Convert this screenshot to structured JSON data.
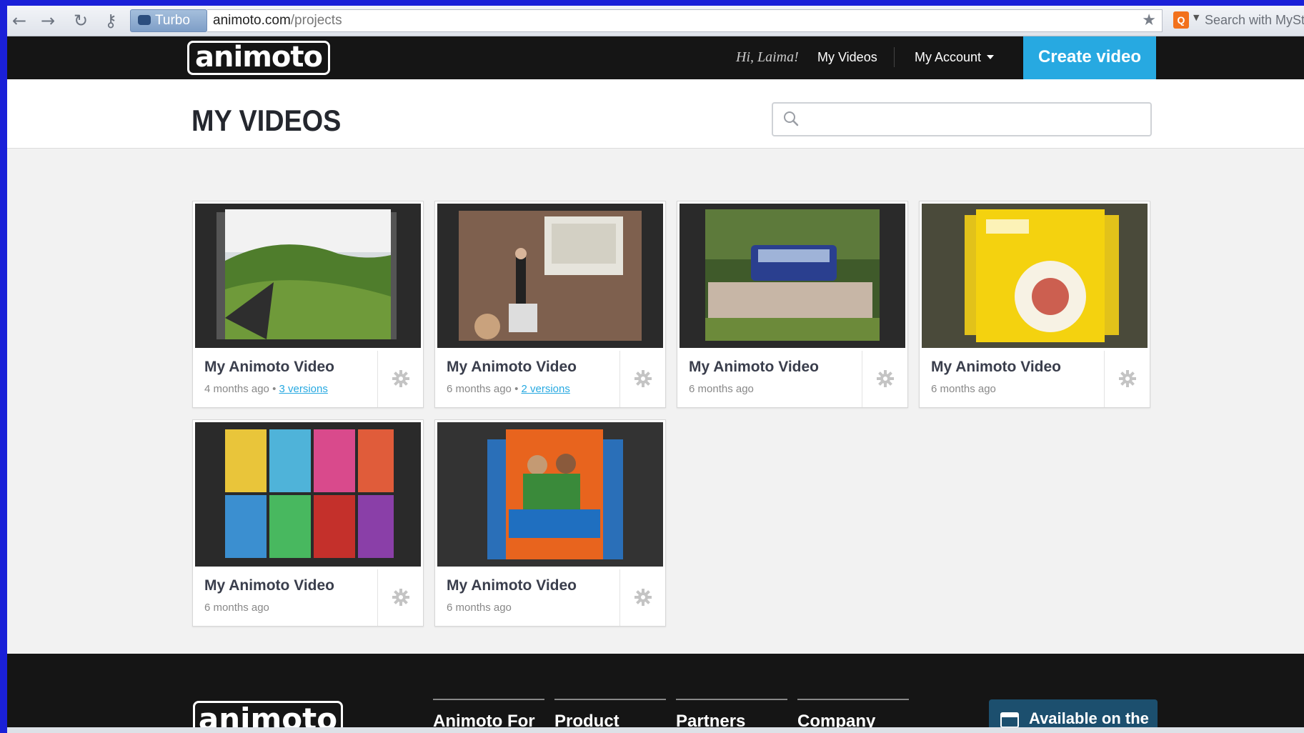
{
  "browser": {
    "turbo_label": "Turbo",
    "url_domain": "animoto.com",
    "url_path": "/projects",
    "search_placeholder": "Search with MyStart"
  },
  "header": {
    "logo_text": "animoto",
    "greeting": "Hi, Laima!",
    "my_videos": "My Videos",
    "my_account": "My Account",
    "create_video": "Create video"
  },
  "page": {
    "title": "MY VIDEOS",
    "search_placeholder": ""
  },
  "videos": [
    {
      "title": "My Animoto Video",
      "age": "4 months ago",
      "versions": "3 versions",
      "thumb": "landscape-hills"
    },
    {
      "title": "My Animoto Video",
      "age": "6 months ago",
      "versions": "2 versions",
      "thumb": "presentation-room"
    },
    {
      "title": "My Animoto Video",
      "age": "6 months ago",
      "versions": "",
      "thumb": "group-bus"
    },
    {
      "title": "My Animoto Video",
      "age": "6 months ago",
      "versions": "",
      "thumb": "early-school-english-book"
    },
    {
      "title": "My Animoto Video",
      "age": "6 months ago",
      "versions": "",
      "thumb": "upstream-books"
    },
    {
      "title": "My Animoto Video",
      "age": "6 months ago",
      "versions": "",
      "thumb": "project-book"
    }
  ],
  "footer": {
    "logo_text": "animoto",
    "columns": [
      "Animoto For",
      "Product",
      "Partners",
      "Company"
    ],
    "app_badge": "Available on the"
  },
  "colors": {
    "header_bg": "#151515",
    "accent": "#27a9e1",
    "frame": "#1a20d8"
  }
}
